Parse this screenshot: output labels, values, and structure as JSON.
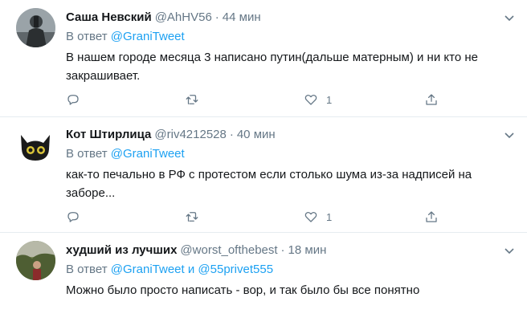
{
  "tweets": [
    {
      "name": "Саша Невский",
      "handle": "@AhHV56",
      "dot": "·",
      "time": "44 мин",
      "reply_prefix": "В ответ",
      "mention1": "@GraniTweet",
      "mention_join": "",
      "mention2": "",
      "text": "В нашем городе месяца 3  написано путин(дальше матерным) и ни кто не закрашивает.",
      "like_count": "1"
    },
    {
      "name": "Кот Штирлица",
      "handle": "@riv4212528",
      "dot": "·",
      "time": "40 мин",
      "reply_prefix": "В ответ",
      "mention1": "@GraniTweet",
      "mention_join": "",
      "mention2": "",
      "text": "как-то печально в РФ с протестом если столько шума из-за надписей на заборе...",
      "like_count": "1"
    },
    {
      "name": "худший из лучших",
      "handle": "@worst_ofthebest",
      "dot": "·",
      "time": "18 мин",
      "reply_prefix": "В ответ",
      "mention1": "@GraniTweet",
      "mention_join": "и",
      "mention2": "@55privet555",
      "text": "Можно было просто написать - вор, и так было бы все понятно",
      "like_count": ""
    }
  ],
  "icons": [
    "reply-icon",
    "retweet-icon",
    "like-icon",
    "share-icon",
    "caret-down-icon"
  ],
  "colors": {
    "mention": "#1da1f2",
    "muted": "#657786",
    "divider": "#e6ecf0"
  }
}
